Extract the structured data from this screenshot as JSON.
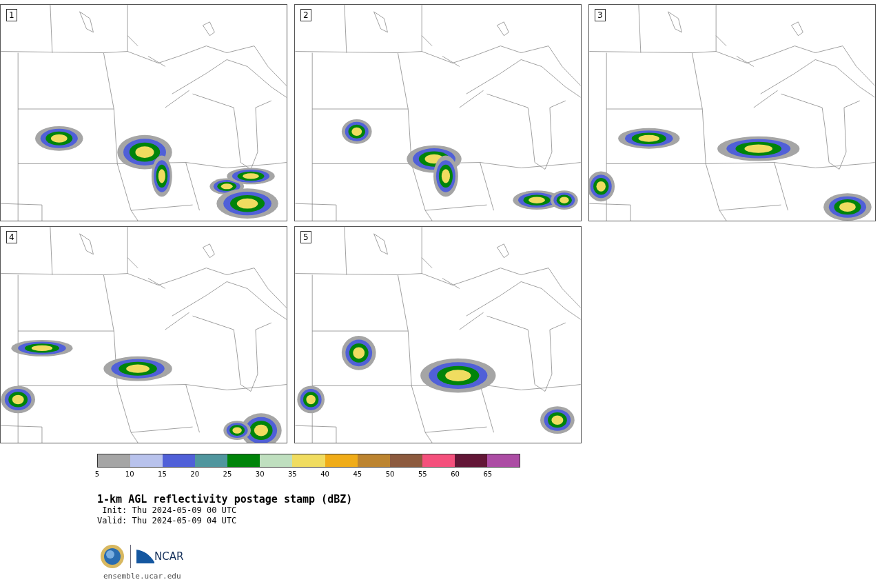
{
  "panels": [
    {
      "number": "1"
    },
    {
      "number": "2"
    },
    {
      "number": "3"
    },
    {
      "number": "4"
    },
    {
      "number": "5"
    }
  ],
  "colorbar": {
    "segments": [
      {
        "color": "#a5a5a5"
      },
      {
        "color": "#b8c2ec"
      },
      {
        "color": "#5060d8"
      },
      {
        "color": "#50969e"
      },
      {
        "color": "#00840a"
      },
      {
        "color": "#bfdfbf"
      },
      {
        "color": "#f0dc60"
      },
      {
        "color": "#f0ac18"
      },
      {
        "color": "#bc8430"
      },
      {
        "color": "#8c5a3e"
      },
      {
        "color": "#f4507c"
      },
      {
        "color": "#621636"
      },
      {
        "color": "#ac4ca4"
      }
    ],
    "ticks": [
      "5",
      "10",
      "15",
      "20",
      "25",
      "30",
      "35",
      "40",
      "45",
      "50",
      "55",
      "60",
      "65"
    ]
  },
  "title": "1-km AGL reflectivity postage stamp (dBZ)",
  "init": " Init: Thu 2024-05-09 00 UTC",
  "valid": "Valid: Thu 2024-05-09 04 UTC",
  "logo": {
    "text": "NCAR",
    "url": "ensemble.ucar.edu"
  }
}
